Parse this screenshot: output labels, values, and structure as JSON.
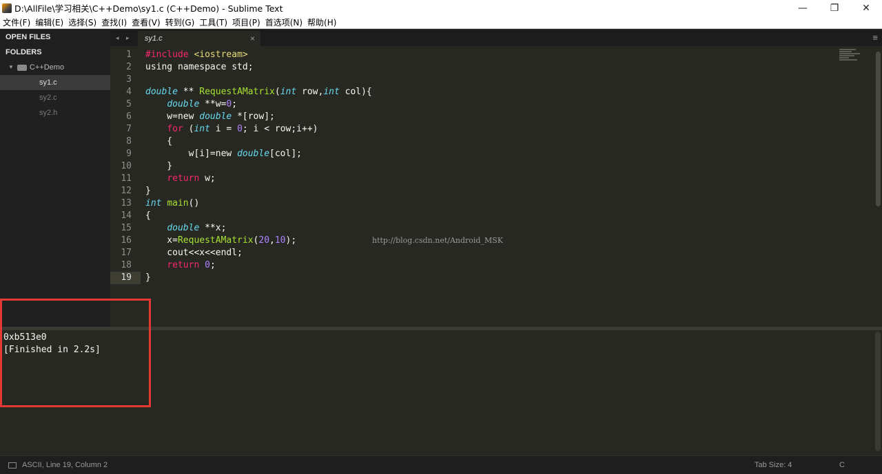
{
  "window": {
    "title": "D:\\AllFile\\学习相关\\C++Demo\\sy1.c (C++Demo) - Sublime Text",
    "minimize_glyph": "—",
    "restore_glyph": "❐",
    "close_glyph": "✕"
  },
  "menu": [
    "文件(F)",
    "编辑(E)",
    "选择(S)",
    "查找(I)",
    "查看(V)",
    "转到(G)",
    "工具(T)",
    "项目(P)",
    "首选项(N)",
    "帮助(H)"
  ],
  "sidebar": {
    "open_files_label": "OPEN FILES",
    "folders_label": "FOLDERS",
    "folder_name": "C++Demo",
    "files": [
      "sy1.c",
      "sy2.c",
      "sy2.h"
    ],
    "active_file": "sy1.c"
  },
  "tabs": {
    "nav": "◂ ▸",
    "active_label": "sy1.c",
    "close_glyph": "×",
    "menu_glyph": "≡"
  },
  "editor": {
    "line_numbers": [
      "1",
      "2",
      "3",
      "4",
      "5",
      "6",
      "7",
      "8",
      "9",
      "10",
      "11",
      "12",
      "13",
      "14",
      "15",
      "16",
      "17",
      "18",
      "19"
    ],
    "current_line": 19,
    "code_lines": [
      [
        {
          "t": "kw",
          "s": "#include "
        },
        {
          "t": "str",
          "s": "<iostream>"
        }
      ],
      [
        {
          "t": "pl",
          "s": "using namespace std;"
        }
      ],
      [
        {
          "t": "pl",
          "s": ""
        }
      ],
      [
        {
          "t": "ty",
          "s": "double"
        },
        {
          "t": "pl",
          "s": " ** "
        },
        {
          "t": "fn",
          "s": "RequestAMatrix"
        },
        {
          "t": "pl",
          "s": "("
        },
        {
          "t": "ty",
          "s": "int"
        },
        {
          "t": "pl",
          "s": " row,"
        },
        {
          "t": "ty",
          "s": "int"
        },
        {
          "t": "pl",
          "s": " col){"
        }
      ],
      [
        {
          "t": "pl",
          "s": "    "
        },
        {
          "t": "ty",
          "s": "double"
        },
        {
          "t": "pl",
          "s": " **w="
        },
        {
          "t": "num",
          "s": "0"
        },
        {
          "t": "pl",
          "s": ";"
        }
      ],
      [
        {
          "t": "pl",
          "s": "    w=new "
        },
        {
          "t": "ty",
          "s": "double"
        },
        {
          "t": "pl",
          "s": " *[row];"
        }
      ],
      [
        {
          "t": "pl",
          "s": "    "
        },
        {
          "t": "kw",
          "s": "for"
        },
        {
          "t": "pl",
          "s": " ("
        },
        {
          "t": "ty",
          "s": "int"
        },
        {
          "t": "pl",
          "s": " i = "
        },
        {
          "t": "num",
          "s": "0"
        },
        {
          "t": "pl",
          "s": "; i < row;i++)"
        }
      ],
      [
        {
          "t": "pl",
          "s": "    {"
        }
      ],
      [
        {
          "t": "pl",
          "s": "        w[i]=new "
        },
        {
          "t": "ty",
          "s": "double"
        },
        {
          "t": "pl",
          "s": "[col];"
        }
      ],
      [
        {
          "t": "pl",
          "s": "    }"
        }
      ],
      [
        {
          "t": "pl",
          "s": "    "
        },
        {
          "t": "kw",
          "s": "return"
        },
        {
          "t": "pl",
          "s": " w;"
        }
      ],
      [
        {
          "t": "pl",
          "s": "}"
        }
      ],
      [
        {
          "t": "ty",
          "s": "int"
        },
        {
          "t": "pl",
          "s": " "
        },
        {
          "t": "fn",
          "s": "main"
        },
        {
          "t": "pl",
          "s": "()"
        }
      ],
      [
        {
          "t": "pl",
          "s": "{"
        }
      ],
      [
        {
          "t": "pl",
          "s": "    "
        },
        {
          "t": "ty",
          "s": "double"
        },
        {
          "t": "pl",
          "s": " **x;"
        }
      ],
      [
        {
          "t": "pl",
          "s": "    x="
        },
        {
          "t": "ent",
          "s": "RequestAMatrix"
        },
        {
          "t": "pl",
          "s": "("
        },
        {
          "t": "num",
          "s": "20"
        },
        {
          "t": "pl",
          "s": ","
        },
        {
          "t": "num",
          "s": "10"
        },
        {
          "t": "pl",
          "s": ");"
        }
      ],
      [
        {
          "t": "pl",
          "s": "    cout<<x<<endl;"
        }
      ],
      [
        {
          "t": "pl",
          "s": "    "
        },
        {
          "t": "kw",
          "s": "return"
        },
        {
          "t": "pl",
          "s": " "
        },
        {
          "t": "num",
          "s": "0"
        },
        {
          "t": "pl",
          "s": ";"
        }
      ],
      [
        {
          "t": "pl",
          "s": "}"
        }
      ]
    ],
    "watermark": "http://blog.csdn.net/Android_MSK"
  },
  "output": {
    "lines": [
      "0xb513e0",
      "[Finished in 2.2s]"
    ]
  },
  "status": {
    "position": "ASCII, Line 19, Column 2",
    "tab_size": "Tab Size: 4",
    "syntax": "C"
  },
  "colors": {
    "keyword": "#f92672",
    "type": "#66d9ef",
    "function": "#a6e22e",
    "number": "#ae81ff",
    "string": "#e6db74",
    "annotation_box": "#e53935"
  }
}
